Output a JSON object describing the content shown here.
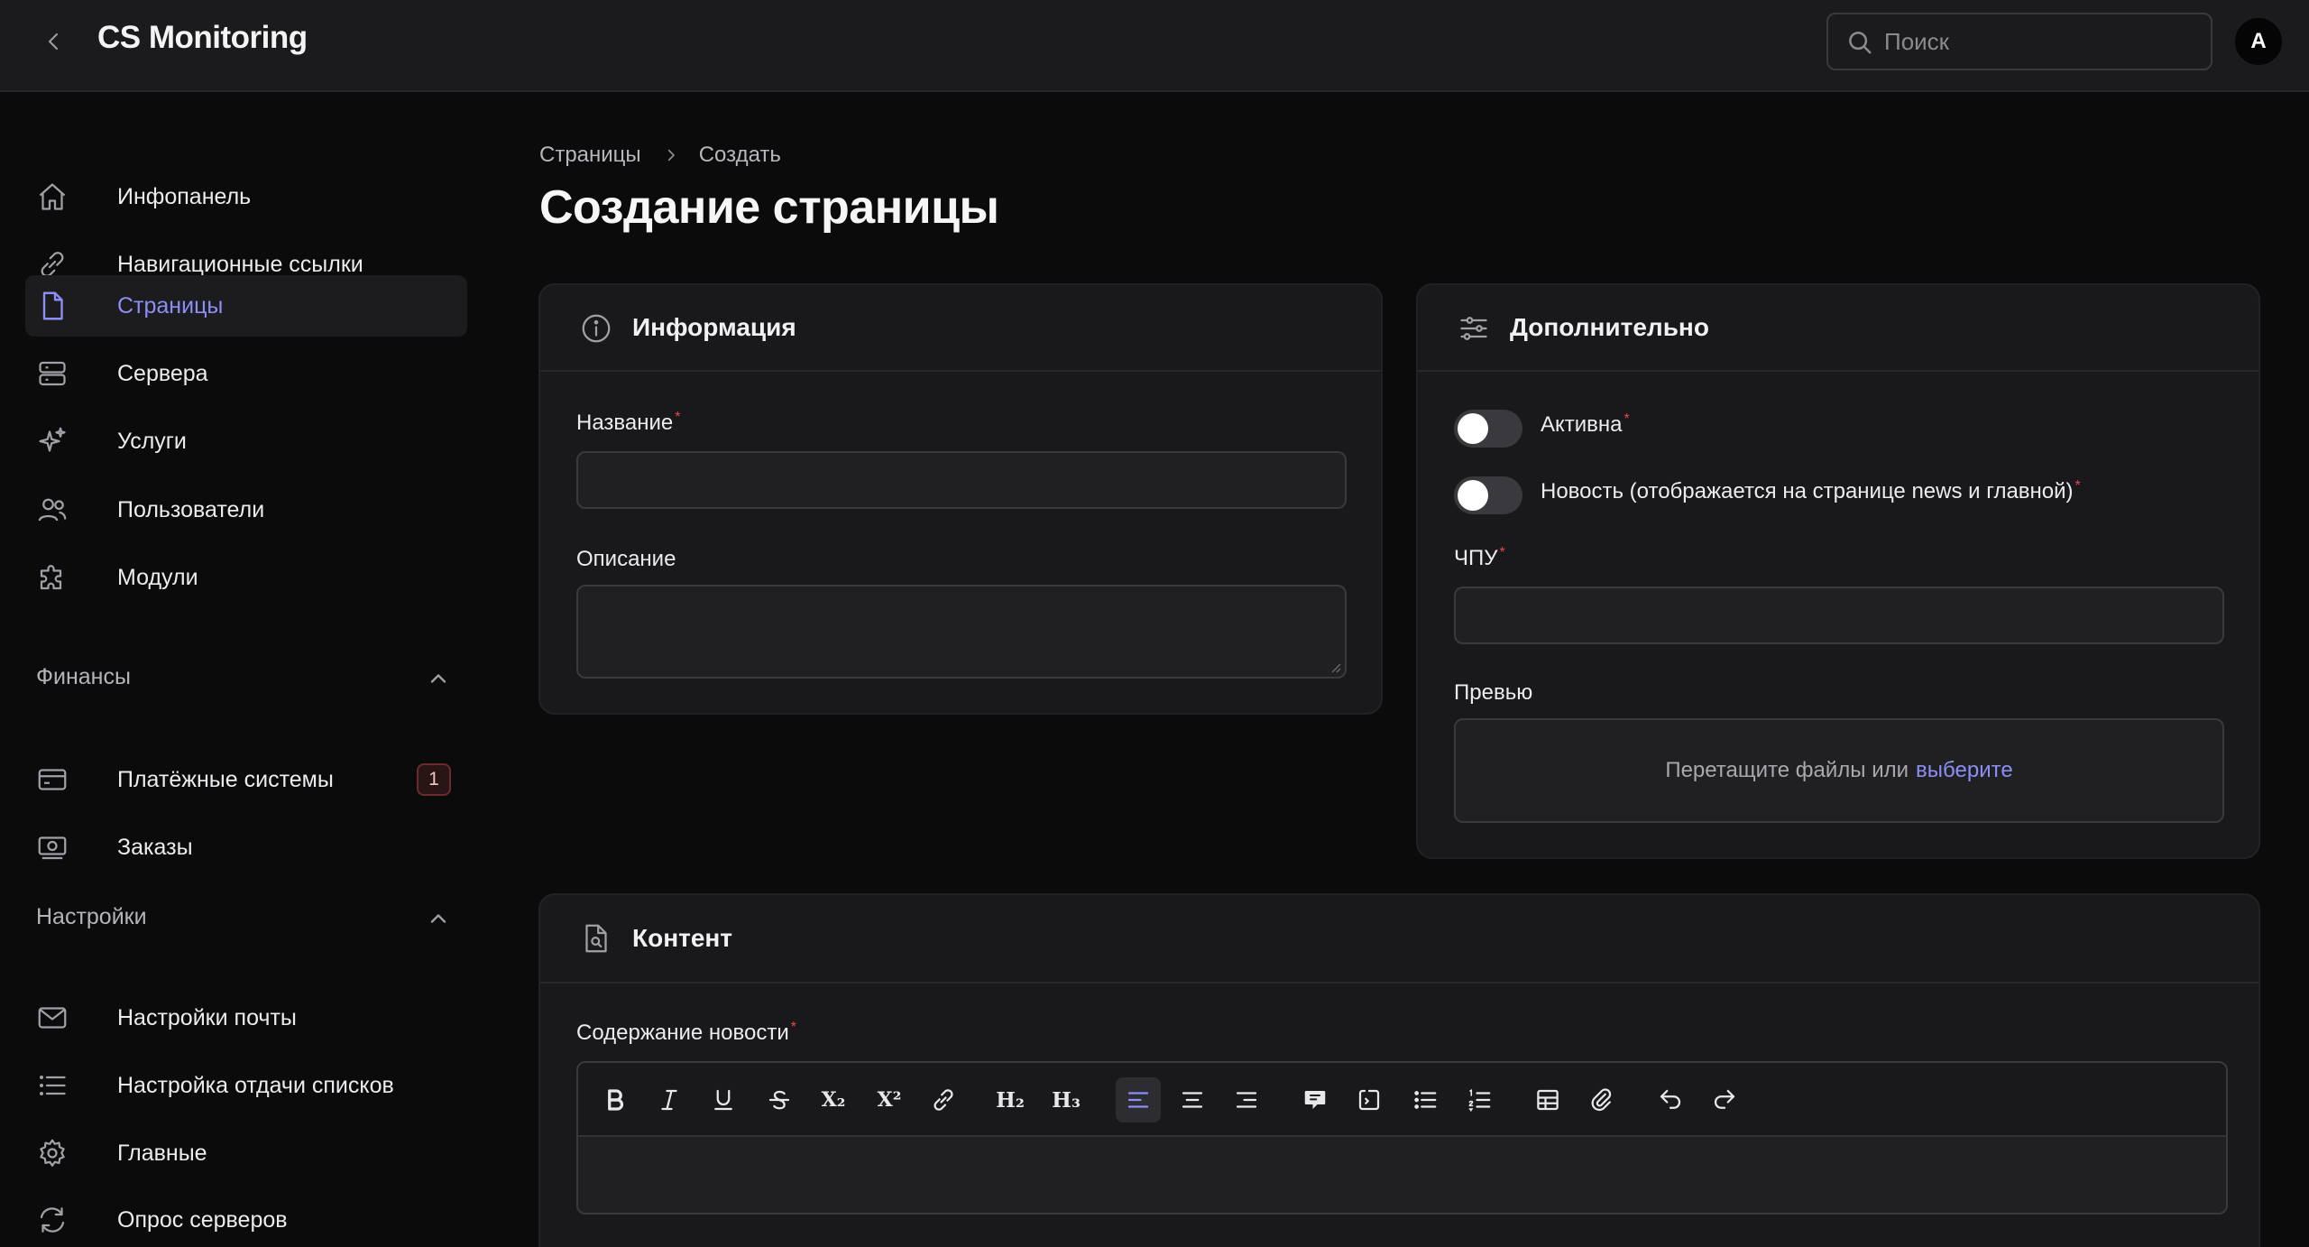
{
  "app": {
    "title": "CS Monitoring"
  },
  "header": {
    "search_placeholder": "Поиск",
    "avatar_initial": "A"
  },
  "sidebar": {
    "items": [
      {
        "label": "Инфопанель",
        "icon": "home-icon"
      },
      {
        "label": "Навигационные ссылки",
        "icon": "link-icon"
      },
      {
        "label": "Страницы",
        "icon": "document-icon",
        "active": true
      },
      {
        "label": "Сервера",
        "icon": "server-icon"
      },
      {
        "label": "Услуги",
        "icon": "sparkles-icon"
      },
      {
        "label": "Пользователи",
        "icon": "users-icon"
      },
      {
        "label": "Модули",
        "icon": "puzzle-icon"
      }
    ],
    "groups": [
      {
        "label": "Финансы",
        "items": [
          {
            "label": "Платёжные системы",
            "icon": "credit-card-icon",
            "badge": "1"
          },
          {
            "label": "Заказы",
            "icon": "cash-icon"
          }
        ]
      },
      {
        "label": "Настройки",
        "items": [
          {
            "label": "Настройки почты",
            "icon": "envelope-icon"
          },
          {
            "label": "Настройка отдачи списков",
            "icon": "list-icon"
          },
          {
            "label": "Главные",
            "icon": "gear-icon"
          },
          {
            "label": "Опрос серверов",
            "icon": "refresh-icon"
          }
        ]
      }
    ]
  },
  "breadcrumb": {
    "parent": "Страницы",
    "current": "Создать"
  },
  "page": {
    "title": "Создание страницы"
  },
  "info_card": {
    "title": "Информация",
    "name_label": "Название",
    "name_value": "",
    "description_label": "Описание",
    "description_value": ""
  },
  "extra_card": {
    "title": "Дополнительно",
    "active_label": "Активна",
    "active_on": false,
    "news_label": "Новость (отображается на странице news и главной)",
    "news_on": false,
    "slug_label": "ЧПУ",
    "slug_value": "",
    "preview_label": "Превью",
    "dropzone_text": "Перетащите файлы или",
    "dropzone_link": "выберите"
  },
  "content_card": {
    "title": "Контент",
    "body_label": "Содержание новости",
    "toolbar": [
      "bold",
      "italic",
      "underline",
      "strike",
      "subscript",
      "superscript",
      "link",
      "h2",
      "h3",
      "align-left",
      "align-center",
      "align-right",
      "blockquote",
      "code-block",
      "bullet-list",
      "ordered-list",
      "table",
      "attach",
      "undo",
      "redo"
    ],
    "h2_label": "H₂",
    "h3_label": "H₃",
    "sub_label": "X₂",
    "sup_label": "X²"
  },
  "colors": {
    "accent": "#8b8ff5",
    "required": "#e5484d",
    "background": "#0b0b0c",
    "card": "#19191b"
  }
}
